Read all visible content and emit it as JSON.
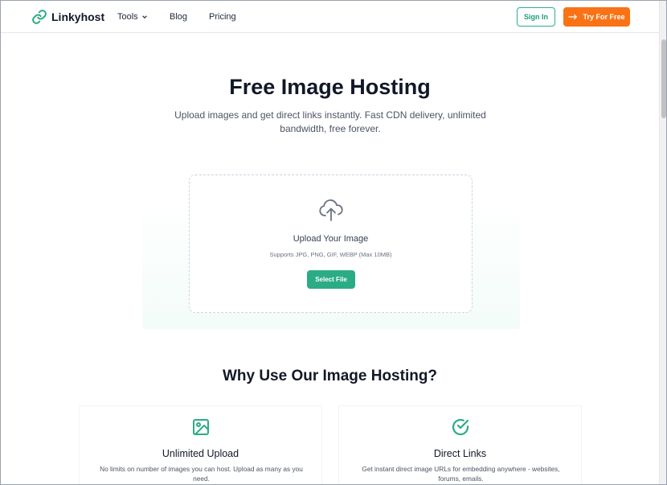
{
  "header": {
    "logo_text": "Linkyhost",
    "nav": [
      {
        "label": "Tools"
      },
      {
        "label": "Blog"
      },
      {
        "label": "Pricing"
      }
    ],
    "signin_label": "Sign In",
    "try_label": "Try For Free"
  },
  "hero": {
    "title": "Free Image Hosting",
    "subtitle": "Upload images and get direct links instantly. Fast CDN delivery, unlimited bandwidth, free forever."
  },
  "upload": {
    "icon": "cloud-upload-icon",
    "title": "Upload Your Image",
    "note": "Supports JPG, PNG, GIF, WEBP (Max 10MB)",
    "button_label": "Select File"
  },
  "why": {
    "title": "Why Use Our Image Hosting?",
    "cards": [
      {
        "icon": "image-icon",
        "title": "Unlimited Upload",
        "desc": "No limits on number of images you can host. Upload as many as you need."
      },
      {
        "icon": "check-circle-icon",
        "title": "Direct Links",
        "desc": "Get instant direct image URLs for embedding anywhere - websites, forums, emails."
      }
    ]
  },
  "colors": {
    "brand_green": "#2bac85",
    "accent_orange": "#f97316"
  }
}
